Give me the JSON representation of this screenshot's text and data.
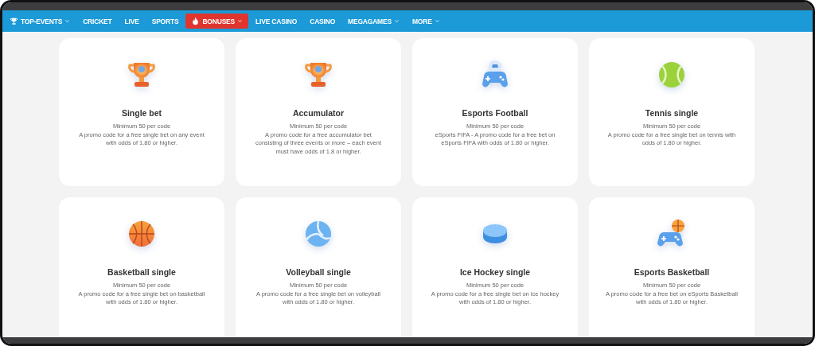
{
  "nav": [
    {
      "label": "TOP-EVENTS",
      "kind": "trophy",
      "dropdown": true,
      "selected": false
    },
    {
      "label": "CRICKET",
      "kind": "plain",
      "dropdown": false,
      "selected": false
    },
    {
      "label": "LIVE",
      "kind": "plain",
      "dropdown": false,
      "selected": false
    },
    {
      "label": "SPORTS",
      "kind": "plain",
      "dropdown": false,
      "selected": false
    },
    {
      "label": "BONUSES",
      "kind": "fire",
      "dropdown": true,
      "selected": true
    },
    {
      "label": "LIVE CASINO",
      "kind": "plain",
      "dropdown": false,
      "selected": false
    },
    {
      "label": "CASINO",
      "kind": "plain",
      "dropdown": false,
      "selected": false
    },
    {
      "label": "MEGAGAMES",
      "kind": "plain",
      "dropdown": true,
      "selected": false
    },
    {
      "label": "MORE",
      "kind": "plain",
      "dropdown": true,
      "selected": false
    }
  ],
  "cards": [
    {
      "kind": "trophy",
      "title": "Single bet",
      "minimum": "Minimum 50 per code",
      "description": "A promo code for a free single bet on any event with odds of 1.80 or higher."
    },
    {
      "kind": "trophy",
      "title": "Accumulator",
      "minimum": "Minimum 50 per code",
      "description": "A promo code for a free accumulator bet consisting of three events or more – each event must have odds of 1.8 or higher."
    },
    {
      "kind": "gamepad-football",
      "title": "Esports Football",
      "minimum": "Minimum 50 per code",
      "description": "eSports FIFA - A promo code for a free bet on eSports FIFA with odds of 1.80 or higher."
    },
    {
      "kind": "tennis",
      "title": "Tennis single",
      "minimum": "Minimum 50 per code",
      "description": "A promo code for a free single bet on tennis with odds of 1.80 or higher."
    },
    {
      "kind": "basketball",
      "title": "Basketball single",
      "minimum": "Minimum 50 per code",
      "description": "A promo code for a free single bet on basketball with odds of 1.80 or higher."
    },
    {
      "kind": "volleyball",
      "title": "Volleyball single",
      "minimum": "Minimum 50 per code",
      "description": "A promo code for a free single bet on volleyball with odds of 1.80 or higher."
    },
    {
      "kind": "puck",
      "title": "Ice Hockey single",
      "minimum": "Minimum 50 per code",
      "description": "A promo code for a free single bet on ice hockey with odds of 1.80 or higher."
    },
    {
      "kind": "gamepad-basketball",
      "title": "Esports Basketball",
      "minimum": "Minimum 50 per code",
      "description": "A promo code for a free bet on eSports Basketball with odds of 1.80 or higher."
    }
  ]
}
